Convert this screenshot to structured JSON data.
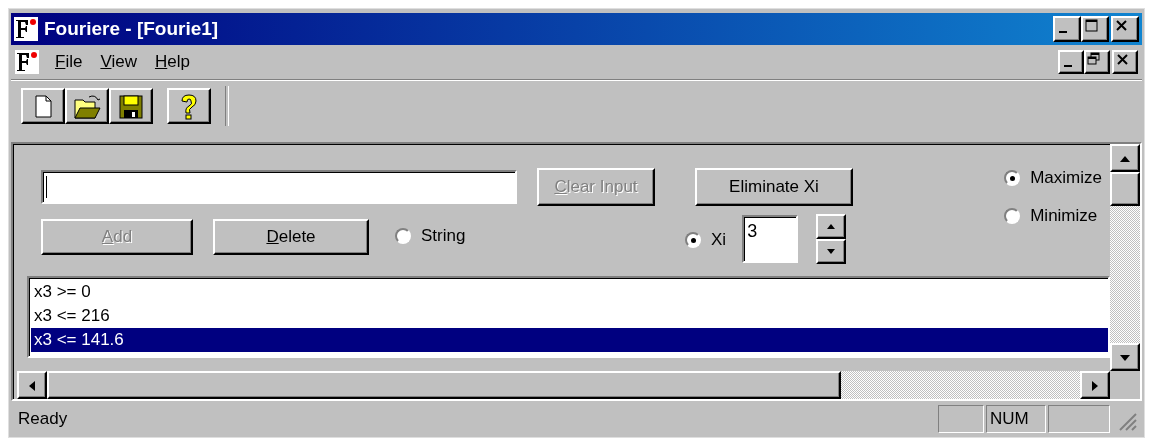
{
  "window": {
    "title": "Fouriere - [Fourie1]"
  },
  "menu": [
    {
      "label": "File",
      "mnemonic": true
    },
    {
      "label": "View",
      "mnemonic": true
    },
    {
      "label": "Help",
      "mnemonic": true
    }
  ],
  "form": {
    "buttons": [
      {
        "kind": "clear",
        "label": "Clear Input",
        "disabled": true,
        "mnemonic": true
      },
      {
        "kind": "eliminate",
        "label": "Eliminate Xi",
        "disabled": false,
        "mnemonic": false
      },
      {
        "kind": "add",
        "label": "Add",
        "disabled": true,
        "mnemonic": true
      },
      {
        "kind": "delete",
        "label": "Delete",
        "disabled": false,
        "mnemonic": true
      }
    ],
    "string_option": {
      "label": "String",
      "selected": false
    },
    "xi_option": {
      "label": "Xi",
      "selected": true
    },
    "xi_value": "3",
    "goal": [
      {
        "label": "Maximize",
        "selected": true
      },
      {
        "label": "Minimize",
        "selected": false
      }
    ]
  },
  "constraints": [
    {
      "text": "x3 >= 0",
      "selected": false
    },
    {
      "text": "x3 <= 216",
      "selected": false
    },
    {
      "text": "x3 <= 141.6",
      "selected": true
    }
  ],
  "status_bar": {
    "text": "Ready",
    "indicator": "NUM"
  }
}
